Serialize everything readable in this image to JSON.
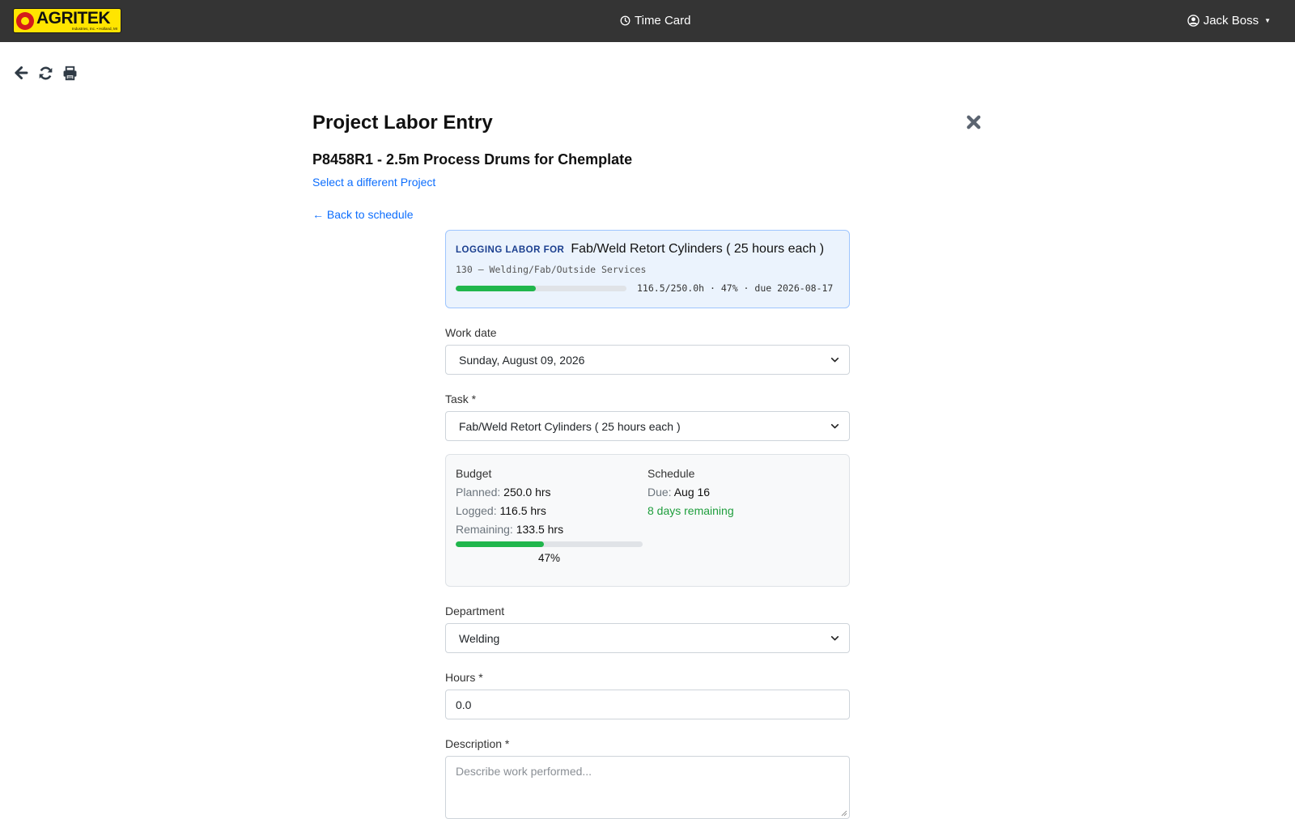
{
  "navbar": {
    "logo_text": "AGRITEK",
    "logo_subtext": "Industries, Inc. • Holland, MI",
    "title": "Time Card",
    "user": "Jack Boss"
  },
  "toolbar": {
    "icons": [
      "arrow-left-icon",
      "refresh-icon",
      "print-icon"
    ]
  },
  "page": {
    "title": "Project Labor Entry",
    "project": "P8458R1 - 2.5m Process Drums for Chemplate",
    "select_project_link": "Select a different Project",
    "back_link": "← Back to schedule"
  },
  "logging": {
    "label": "LOGGING LABOR FOR",
    "task": "Fab/Weld Retort Cylinders ( 25 hours each )",
    "category": "130 – Welding/Fab/Outside Services",
    "progress_fraction": 0.47,
    "stats": "116.5/250.0h · 47% · due 2026-08-17"
  },
  "form": {
    "work_date": {
      "label": "Work date",
      "value": "Sunday, August 09, 2026"
    },
    "task": {
      "label": "Task *",
      "value": "Fab/Weld Retort Cylinders ( 25 hours each )"
    },
    "department": {
      "label": "Department",
      "value": "Welding"
    },
    "hours": {
      "label": "Hours *",
      "value": "0.0"
    },
    "description": {
      "label": "Description *",
      "placeholder": "Describe work performed..."
    }
  },
  "budget": {
    "heading": "Budget",
    "planned_label": "Planned:",
    "planned": "250.0 hrs",
    "logged_label": "Logged:",
    "logged": "116.5 hrs",
    "remaining_label": "Remaining:",
    "remaining": "133.5 hrs",
    "progress_fraction": 0.47,
    "percent_text": "47%"
  },
  "schedule": {
    "heading": "Schedule",
    "due_label": "Due:",
    "due": "Aug 16",
    "days_remaining": "8 days remaining"
  },
  "colors": {
    "navbar_bg": "#343434",
    "link": "#0d6efd",
    "progress": "#20b64c",
    "success_text": "#1e9e3c",
    "logging_card_bg": "#ebf3fd",
    "logging_card_border": "#9ec5fe"
  }
}
